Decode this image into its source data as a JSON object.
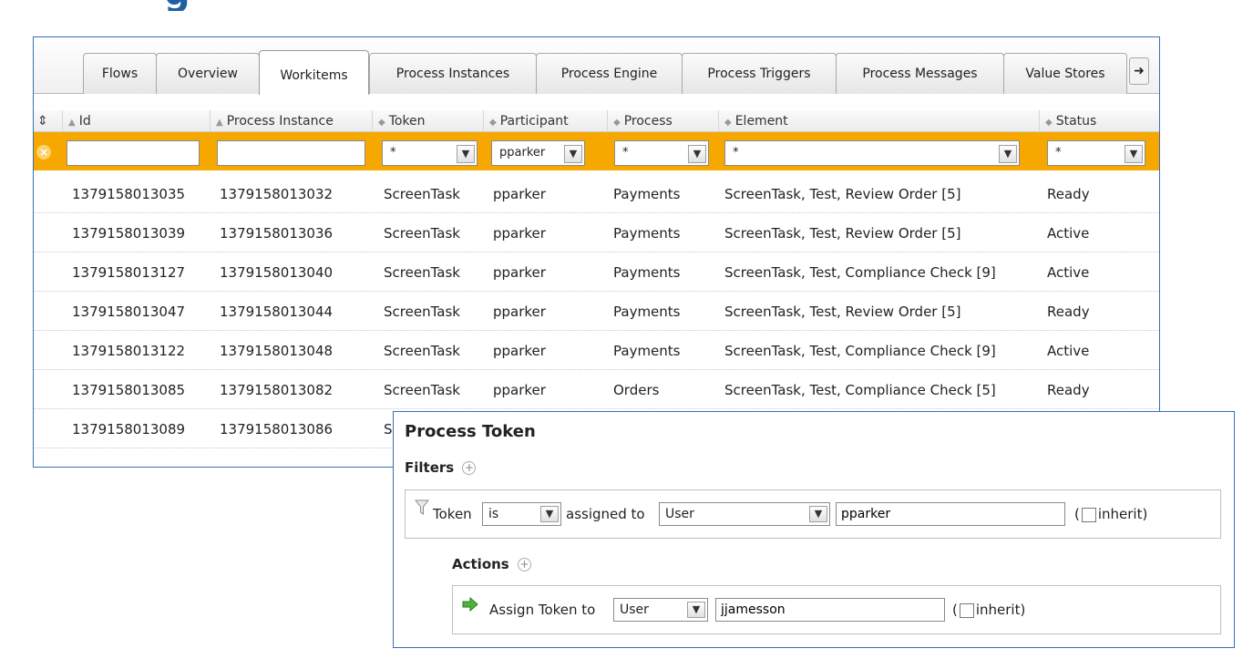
{
  "tabs": [
    "Flows",
    "Overview",
    "Workitems",
    "Process Instances",
    "Process Engine",
    "Process Triggers",
    "Process Messages",
    "Value Stores"
  ],
  "active_tab": "Workitems",
  "columns": {
    "id": "Id",
    "process_instance": "Process Instance",
    "token": "Token",
    "participant": "Participant",
    "process": "Process",
    "element": "Element",
    "status": "Status"
  },
  "filters": {
    "id": "",
    "process_instance": "",
    "token": "*",
    "participant": "pparker",
    "process": "*",
    "element": "*",
    "status": "*"
  },
  "rows": [
    {
      "id": "1379158013035",
      "process_instance": "1379158013032",
      "token": "ScreenTask",
      "participant": "pparker",
      "process": "Payments",
      "element": "ScreenTask, Test, Review Order [5]",
      "status": "Ready"
    },
    {
      "id": "1379158013039",
      "process_instance": "1379158013036",
      "token": "ScreenTask",
      "participant": "pparker",
      "process": "Payments",
      "element": "ScreenTask, Test, Review Order [5]",
      "status": "Active"
    },
    {
      "id": "1379158013127",
      "process_instance": "1379158013040",
      "token": "ScreenTask",
      "participant": "pparker",
      "process": "Payments",
      "element": "ScreenTask, Test, Compliance Check [9]",
      "status": "Active"
    },
    {
      "id": "1379158013047",
      "process_instance": "1379158013044",
      "token": "ScreenTask",
      "participant": "pparker",
      "process": "Payments",
      "element": "ScreenTask, Test, Review Order [5]",
      "status": "Ready"
    },
    {
      "id": "1379158013122",
      "process_instance": "1379158013048",
      "token": "ScreenTask",
      "participant": "pparker",
      "process": "Payments",
      "element": "ScreenTask, Test, Compliance Check [9]",
      "status": "Active"
    },
    {
      "id": "1379158013085",
      "process_instance": "1379158013082",
      "token": "ScreenTask",
      "participant": "pparker",
      "process": "Orders",
      "element": "ScreenTask, Test, Compliance Check [5]",
      "status": "Ready"
    },
    {
      "id": "1379158013089",
      "process_instance": "1379158013086",
      "token": "S",
      "participant": "",
      "process": "",
      "element": "",
      "status": ""
    }
  ],
  "token_panel": {
    "title": "Process Token",
    "filters_label": "Filters",
    "filter": {
      "token_label": "Token",
      "operator": "is",
      "assigned_to_label": "assigned to",
      "assignee_type": "User",
      "assignee": "pparker",
      "open_paren": "(",
      "inherit_label": "inherit",
      "close_paren": ")"
    },
    "actions_label": "Actions",
    "action": {
      "label": "Assign Token to",
      "assignee_type": "User",
      "assignee": "jjamesson",
      "open_paren": "(",
      "inherit_label": "inherit",
      "close_paren": ")"
    }
  },
  "colors": {
    "accent_border": "#3a6fb0",
    "filter_bar": "#f7a800",
    "title_blue": "#1f5fa8"
  }
}
